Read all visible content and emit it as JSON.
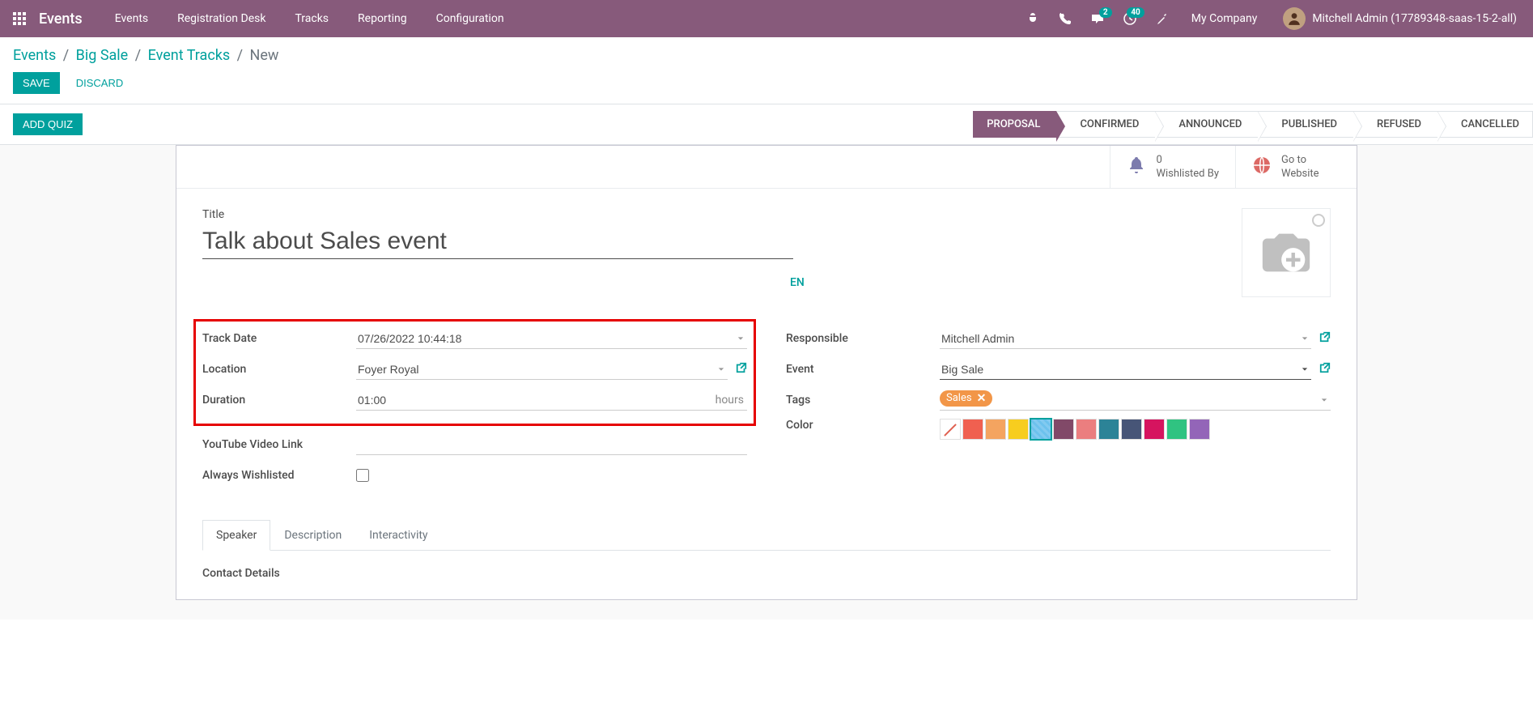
{
  "navbar": {
    "brand": "Events",
    "menu": [
      "Events",
      "Registration Desk",
      "Tracks",
      "Reporting",
      "Configuration"
    ],
    "messaging_badge": "2",
    "activities_badge": "40",
    "company": "My Company",
    "user": "Mitchell Admin (17789348-saas-15-2-all)"
  },
  "breadcrumb": {
    "items": [
      "Events",
      "Big Sale",
      "Event Tracks"
    ],
    "current": "New"
  },
  "actions": {
    "save": "SAVE",
    "discard": "DISCARD",
    "add_quiz": "ADD QUIZ"
  },
  "statusbar": [
    "PROPOSAL",
    "CONFIRMED",
    "ANNOUNCED",
    "PUBLISHED",
    "REFUSED",
    "CANCELLED"
  ],
  "button_box": {
    "wishlist_count": "0",
    "wishlist_label": "Wishlisted By",
    "website_line1": "Go to",
    "website_line2": "Website"
  },
  "form": {
    "title_label": "Title",
    "title_value": "Talk about Sales event",
    "lang": "EN",
    "labels": {
      "track_date": "Track Date",
      "location": "Location",
      "duration": "Duration",
      "youtube": "YouTube Video Link",
      "always_wishlisted": "Always Wishlisted",
      "responsible": "Responsible",
      "event": "Event",
      "tags": "Tags",
      "color": "Color"
    },
    "values": {
      "track_date": "07/26/2022 10:44:18",
      "location": "Foyer Royal",
      "duration": "01:00",
      "duration_suffix": "hours",
      "youtube": "",
      "responsible": "Mitchell Admin",
      "event": "Big Sale",
      "tag": "Sales"
    },
    "colors": [
      "none",
      "#F06050",
      "#F4A460",
      "#F7CD1F",
      "#6CC1ED",
      "#814968",
      "#EB7E7F",
      "#2C8397",
      "#475577",
      "#D6145F",
      "#30C381",
      "#9365B8"
    ],
    "color_selected_index": 4
  },
  "tabs": [
    "Speaker",
    "Description",
    "Interactivity"
  ],
  "section_title": "Contact Details"
}
